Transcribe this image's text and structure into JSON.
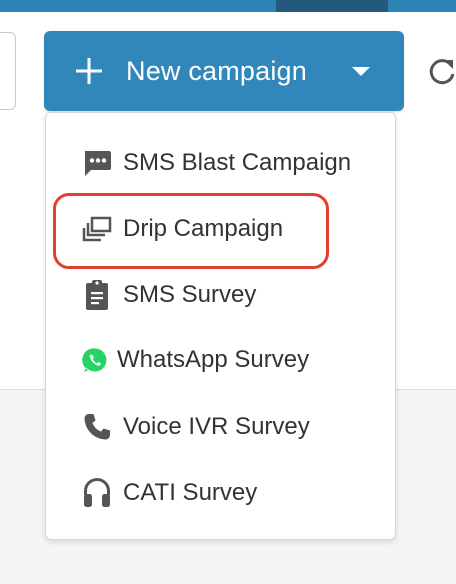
{
  "header": {
    "new_campaign_label": "New campaign"
  },
  "menu": {
    "items": [
      {
        "label": "SMS Blast Campaign",
        "icon": "sms-message-icon"
      },
      {
        "label": "Drip Campaign",
        "icon": "drip-stack-icon"
      },
      {
        "label": "SMS Survey",
        "icon": "clipboard-icon"
      },
      {
        "label": "WhatsApp Survey",
        "icon": "whatsapp-icon"
      },
      {
        "label": "Voice IVR Survey",
        "icon": "phone-icon"
      },
      {
        "label": "CATI Survey",
        "icon": "headset-icon"
      }
    ],
    "highlighted": "Drip Campaign"
  },
  "colors": {
    "primary": "#3187ba",
    "top_bar": "#2e83b6",
    "highlight": "#e0402c",
    "whatsapp": "#25d366",
    "icon": "#555555"
  }
}
